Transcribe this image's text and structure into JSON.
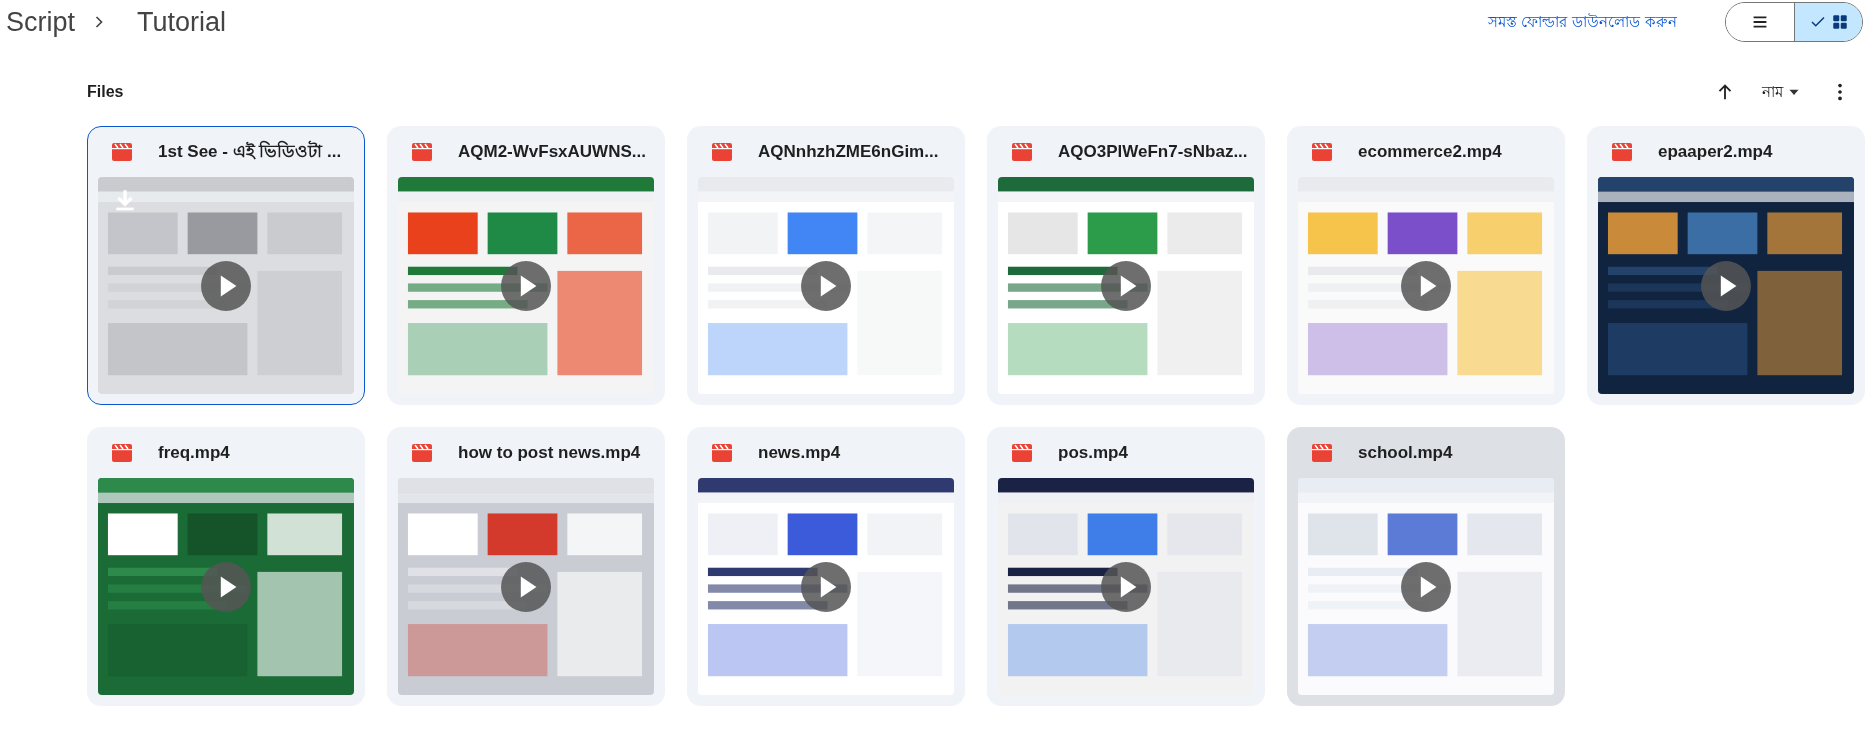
{
  "breadcrumb": [
    "Script",
    "Tutorial"
  ],
  "download_all": "সমস্ত ফোল্ডার ডাউনলোড করুন",
  "view_toggle": {
    "list_selected": false,
    "grid_selected": true
  },
  "section_title": "Files",
  "sort": {
    "label": "নাম"
  },
  "files": [
    {
      "name": "1st See - এই ভিডিওটা ...",
      "selected": true,
      "highlighted": false,
      "download_badge": true
    },
    {
      "name": "AQM2-WvFsxAUWNS...",
      "selected": false,
      "highlighted": false,
      "download_badge": false
    },
    {
      "name": "AQNnhzhZME6nGim...",
      "selected": false,
      "highlighted": false,
      "download_badge": false
    },
    {
      "name": "AQO3PlWeFn7-sNbaz...",
      "selected": false,
      "highlighted": false,
      "download_badge": false
    },
    {
      "name": "ecommerce2.mp4",
      "selected": false,
      "highlighted": false,
      "download_badge": false
    },
    {
      "name": "epaaper2.mp4",
      "selected": false,
      "highlighted": false,
      "download_badge": false
    },
    {
      "name": "freq.mp4",
      "selected": false,
      "highlighted": false,
      "download_badge": false
    },
    {
      "name": "how to post news.mp4",
      "selected": false,
      "highlighted": false,
      "download_badge": false
    },
    {
      "name": "news.mp4",
      "selected": false,
      "highlighted": false,
      "download_badge": false
    },
    {
      "name": "pos.mp4",
      "selected": false,
      "highlighted": false,
      "download_badge": false
    },
    {
      "name": "school.mp4",
      "selected": false,
      "highlighted": true,
      "download_badge": false
    }
  ]
}
